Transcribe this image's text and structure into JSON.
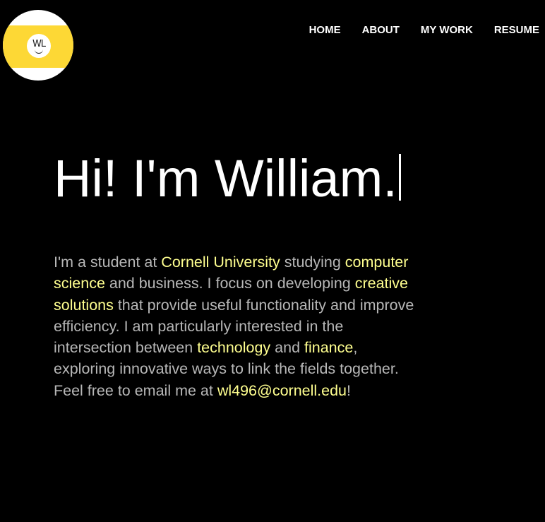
{
  "logo": {
    "initials": "WL"
  },
  "nav": {
    "items": [
      {
        "label": "HOME"
      },
      {
        "label": "ABOUT"
      },
      {
        "label": "MY WORK"
      },
      {
        "label": "RESUME"
      }
    ]
  },
  "hero": {
    "title": "Hi! I'm William."
  },
  "intro": {
    "t1": "I'm a student at ",
    "h1": "Cornell University",
    "t2": " studying ",
    "h2": "computer science",
    "t3": " and business. I focus on developing ",
    "h3": "creative solutions",
    "t4": " that provide useful functionality and improve efficiency. I am particularly interested in the intersection between ",
    "h4": "technology",
    "t5": " and ",
    "h5": "finance",
    "t6": ", exploring innovative ways to link the fields together. Feel free to email me at ",
    "email": "wl496@cornell.edu",
    "t7": "!"
  },
  "colors": {
    "background": "#000000",
    "highlight": "#ffff8f",
    "body_text": "#b7b7b7",
    "logo_yellow": "#fdd835"
  }
}
